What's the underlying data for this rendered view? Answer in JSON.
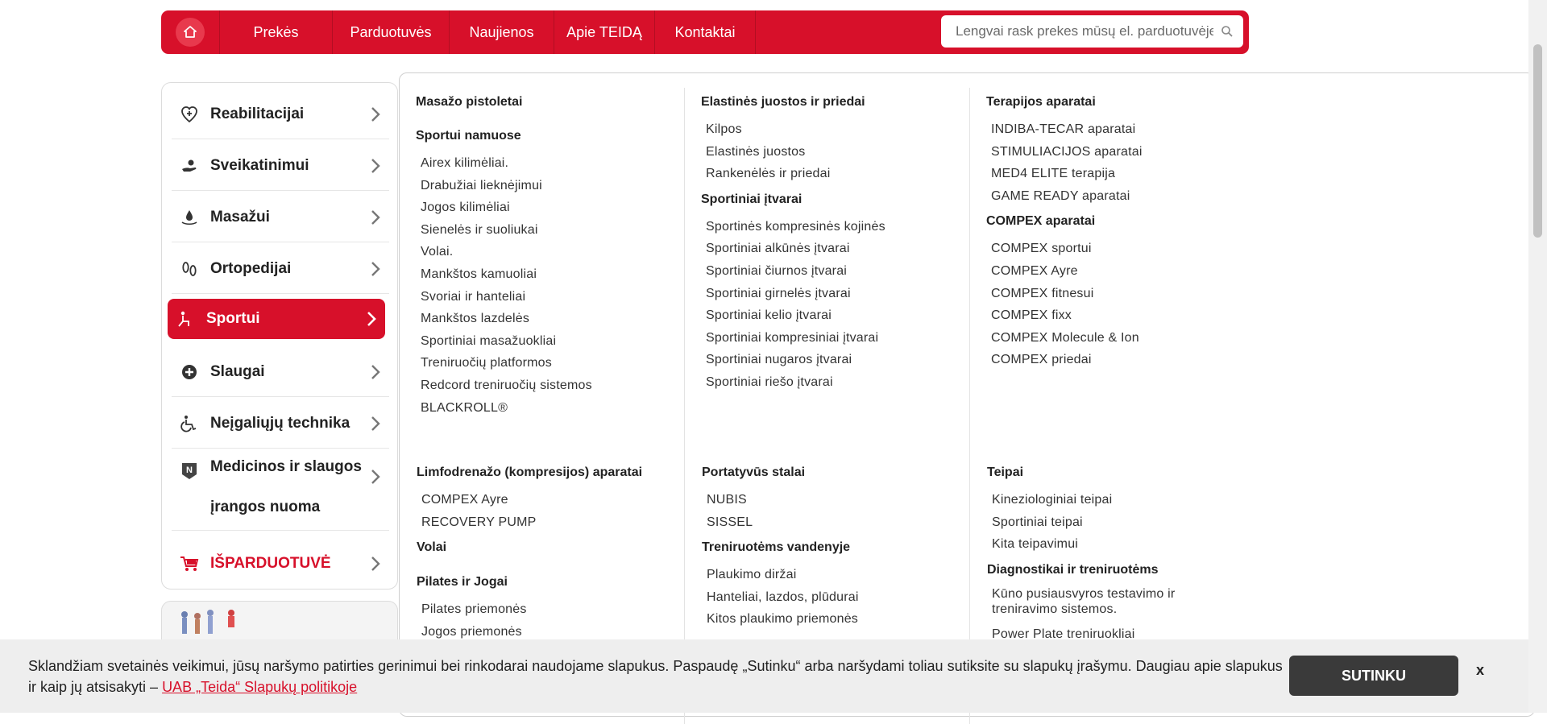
{
  "nav": {
    "items": [
      "Prekės",
      "Parduotuvės",
      "Naujienos",
      "Apie TEIDĄ",
      "Kontaktai"
    ],
    "search_placeholder": "Lengvai rask prekes mūsų el. parduotuvėje"
  },
  "sidebar": {
    "items": [
      {
        "label": "Reabilitacijai",
        "icon": "rehab-icon"
      },
      {
        "label": "Sveikatinimui",
        "icon": "wellness-hand-icon"
      },
      {
        "label": "Masažui",
        "icon": "massage-drop-icon"
      },
      {
        "label": "Ortopedijai",
        "icon": "footprints-icon"
      },
      {
        "label": "Sportui",
        "icon": "sport-icon",
        "active": true
      },
      {
        "label": "Slaugai",
        "icon": "plus-circle-icon"
      },
      {
        "label": "Neįgaliųjų technika",
        "icon": "wheelchair-icon"
      },
      {
        "label": "Medicinos ir slaugos įrangos nuoma",
        "icon": "rental-badge-icon"
      },
      {
        "label": "IŠPARDUOTUVĖ",
        "icon": "cart-icon"
      }
    ]
  },
  "mega": {
    "col1": {
      "heading1": "Masažo pistoletai",
      "heading2": "Sportui namuose",
      "links": [
        "Airex kilimėliai.",
        "Drabužiai lieknėjimui",
        "Jogos kilimėliai",
        "Sienelės ir suoliukai",
        "Volai.",
        "Mankštos kamuoliai",
        "Svoriai ir hanteliai",
        "Mankštos lazdelės",
        "Sportiniai masažuokliai",
        "Treniruočių platformos",
        "Redcord treniruočių sistemos",
        "BLACKROLL®"
      ]
    },
    "col2": {
      "heading1": "Elastinės juostos ir priedai",
      "links1": [
        "Kilpos",
        "Elastinės juostos",
        "Rankenėlės ir priedai"
      ],
      "heading2": "Sportiniai įtvarai",
      "links2": [
        "Sportinės kompresinės kojinės",
        "Sportiniai alkūnės įtvarai",
        "Sportiniai čiurnos įtvarai",
        "Sportiniai girnelės įtvarai",
        "Sportiniai kelio įtvarai",
        "Sportiniai kompresiniai įtvarai",
        "Sportiniai nugaros įtvarai",
        "Sportiniai riešo įtvarai"
      ]
    },
    "col3": {
      "heading1": "Terapijos aparatai",
      "links1": [
        "INDIBA-TECAR aparatai",
        "STIMULIACIJOS aparatai",
        "MED4 ELITE terapija",
        "GAME READY aparatai"
      ],
      "heading2": "COMPEX aparatai",
      "links2": [
        "COMPEX sportui",
        "COMPEX Ayre",
        "COMPEX fitnesui",
        "COMPEX fixx",
        "COMPEX Molecule & Ion",
        "COMPEX priedai"
      ]
    },
    "col4": {
      "heading1": "Limfodrenažo (kompresijos) aparatai",
      "links1": [
        "COMPEX Ayre",
        "RECOVERY PUMP"
      ],
      "heading2": "Volai",
      "heading3": "Pilates ir Jogai",
      "links3": [
        "Pilates priemonės",
        "Jogos priemonės"
      ]
    },
    "col5": {
      "heading1": "Portatyvūs stalai",
      "links1": [
        "NUBIS",
        "SISSEL"
      ],
      "heading2": "Treniruotėms vandenyje",
      "links2": [
        "Plaukimo diržai",
        "Hanteliai, lazdos, plūdurai",
        "Kitos plaukimo priemonės"
      ]
    },
    "col6": {
      "heading1": "Teipai",
      "links1": [
        "Kineziologiniai teipai",
        "Sportiniai teipai",
        "Kita teipavimui"
      ],
      "heading2": "Diagnostikai ir treniruotėms",
      "links2": [
        "Kūno pusiausvyros testavimo ir treniravimo sistemos.",
        "Power Plate treniruokliai"
      ]
    }
  },
  "cookie": {
    "text": "Sklandžiam svetainės veikimui, jūsų naršymo patirties gerinimui bei rinkodarai naudojame slapukus. Paspaudę „Sutinku“ arba naršydami toliau sutiksite su slapukų įrašymu. Daugiau apie slapukus ir kaip jų atsisakyti – ",
    "link": "UAB „Teida“ Slapukų politikoje ",
    "accept": "SUTINKU",
    "close": "x"
  }
}
